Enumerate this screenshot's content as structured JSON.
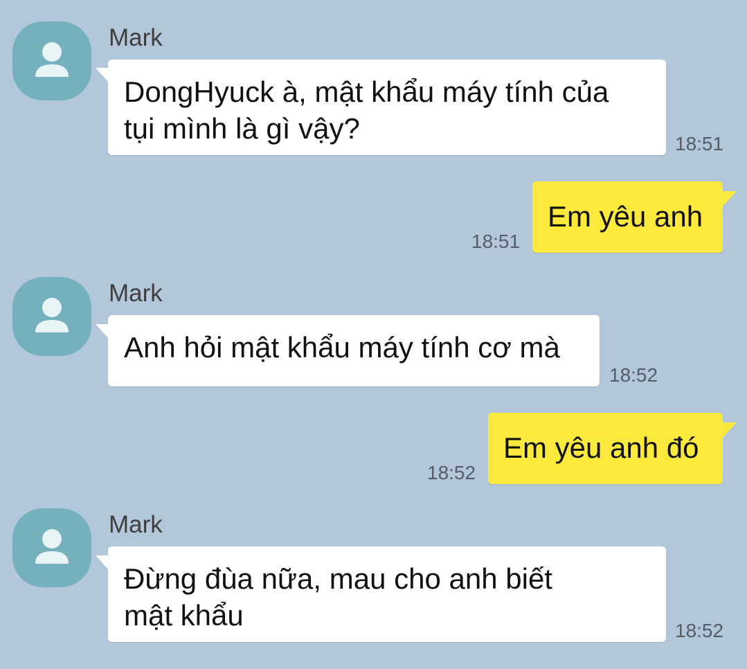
{
  "colors": {
    "background": "#b2c7da",
    "incoming_bubble": "#ffffff",
    "outgoing_bubble": "#fbe93d",
    "avatar": "#74b1bc"
  },
  "messages": [
    {
      "direction": "in",
      "sender": "Mark",
      "text_lines": [
        "DongHyuck à, mật khẩu máy tính của",
        "tụi mình là gì vậy?"
      ],
      "time": "18:51"
    },
    {
      "direction": "out",
      "text_lines": [
        "Em yêu anh"
      ],
      "time": "18:51"
    },
    {
      "direction": "in",
      "sender": "Mark",
      "text_lines": [
        "Anh hỏi mật khẩu máy tính cơ mà"
      ],
      "time": "18:52"
    },
    {
      "direction": "out",
      "text_lines": [
        "Em yêu anh đó"
      ],
      "time": "18:52"
    },
    {
      "direction": "in",
      "sender": "Mark",
      "text_lines": [
        "Đừng đùa nữa, mau cho anh biết",
        "mật khẩu"
      ],
      "time": "18:52"
    }
  ],
  "icons": {
    "avatar": "default-profile-icon"
  }
}
